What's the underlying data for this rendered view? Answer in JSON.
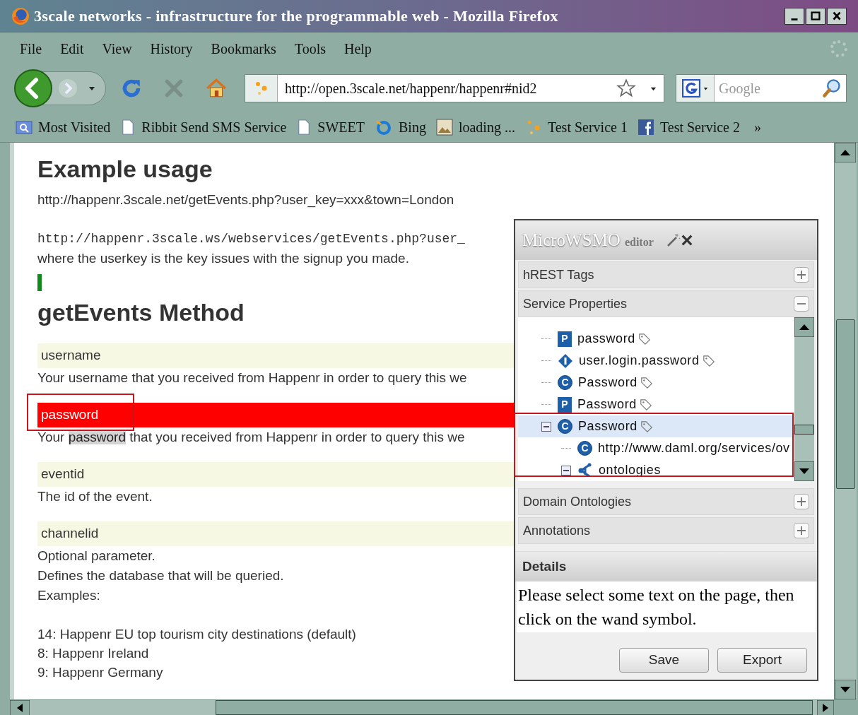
{
  "window": {
    "title": "3scale networks - infrastructure for the programmable web - Mozilla Firefox"
  },
  "menu": [
    "File",
    "Edit",
    "View",
    "History",
    "Bookmarks",
    "Tools",
    "Help"
  ],
  "address_bar": {
    "value": "http://open.3scale.net/happenr/happenr#nid2"
  },
  "search": {
    "placeholder": "Google"
  },
  "bookmarks": [
    {
      "label": "Most Visited",
      "kind": "folder"
    },
    {
      "label": "Ribbit Send SMS Service",
      "kind": "page"
    },
    {
      "label": "SWEET",
      "kind": "page"
    },
    {
      "label": "Bing",
      "kind": "bing"
    },
    {
      "label": "loading ...",
      "kind": "image"
    },
    {
      "label": "Test Service 1",
      "kind": "dots"
    },
    {
      "label": "Test Service 2",
      "kind": "facebook"
    }
  ],
  "bookmarks_overflow": "»",
  "page": {
    "heading": "Example usage",
    "example_url": "http://happenr.3scale.net/getEvents.php?user_key=xxx&town=London",
    "code_url": "http://happenr.3scale.ws/webservices/getEvents.php?user_",
    "note": "where the userkey is the key issues with the signup you made.",
    "method_heading": "getEvents Method",
    "params": [
      {
        "name": "username",
        "selected": false,
        "description": "Your username that you received from Happenr in order to query this we"
      },
      {
        "name": "password",
        "selected": true,
        "description": {
          "before": "Your ",
          "highlight": "password",
          "after": " that you received from Happenr in order to query this we"
        }
      },
      {
        "name": "eventid",
        "selected": false,
        "description": "The id of the event."
      },
      {
        "name": "channelid",
        "selected": false,
        "lines": [
          "Optional parameter.",
          "Defines the database that will be queried.",
          "Examples:"
        ],
        "examples": [
          "14: Happenr EU top tourism city destinations (default)",
          "8: Happenr Ireland",
          "9: Happenr Germany"
        ]
      }
    ]
  },
  "editor": {
    "title": "MicroWSMO",
    "subtitle": "editor",
    "sections": [
      {
        "title": "hREST Tags",
        "expanded": false
      },
      {
        "title": "Service Properties",
        "expanded": true,
        "tree": [
          {
            "label": "password",
            "kind": "parameter",
            "badge": "P",
            "tagged": true,
            "selected": false
          },
          {
            "label": "user.login.password",
            "kind": "instance",
            "tagged": true,
            "selected": false
          },
          {
            "label": "Password",
            "kind": "concept",
            "badge": "C",
            "tagged": true,
            "selected": false
          },
          {
            "label": "Password",
            "kind": "parameter",
            "badge": "P",
            "tagged": true,
            "selected": false
          },
          {
            "label": "Password",
            "kind": "concept",
            "badge": "C",
            "tagged": true,
            "selected": true,
            "expanded": true,
            "children": [
              {
                "label": "http://www.daml.org/services/ov",
                "kind": "concept",
                "badge": "C",
                "tagged": false,
                "selected": false
              },
              {
                "label": "ontologies",
                "kind": "ontology",
                "tagged": false,
                "selected": false,
                "expanded": true
              }
            ]
          }
        ]
      },
      {
        "title": "Domain Ontologies",
        "expanded": false
      },
      {
        "title": "Annotations",
        "expanded": false
      }
    ],
    "details": {
      "title": "Details",
      "text": "Please select some text on the page, then click on the wand symbol."
    },
    "buttons": [
      "Save",
      "Export"
    ]
  }
}
